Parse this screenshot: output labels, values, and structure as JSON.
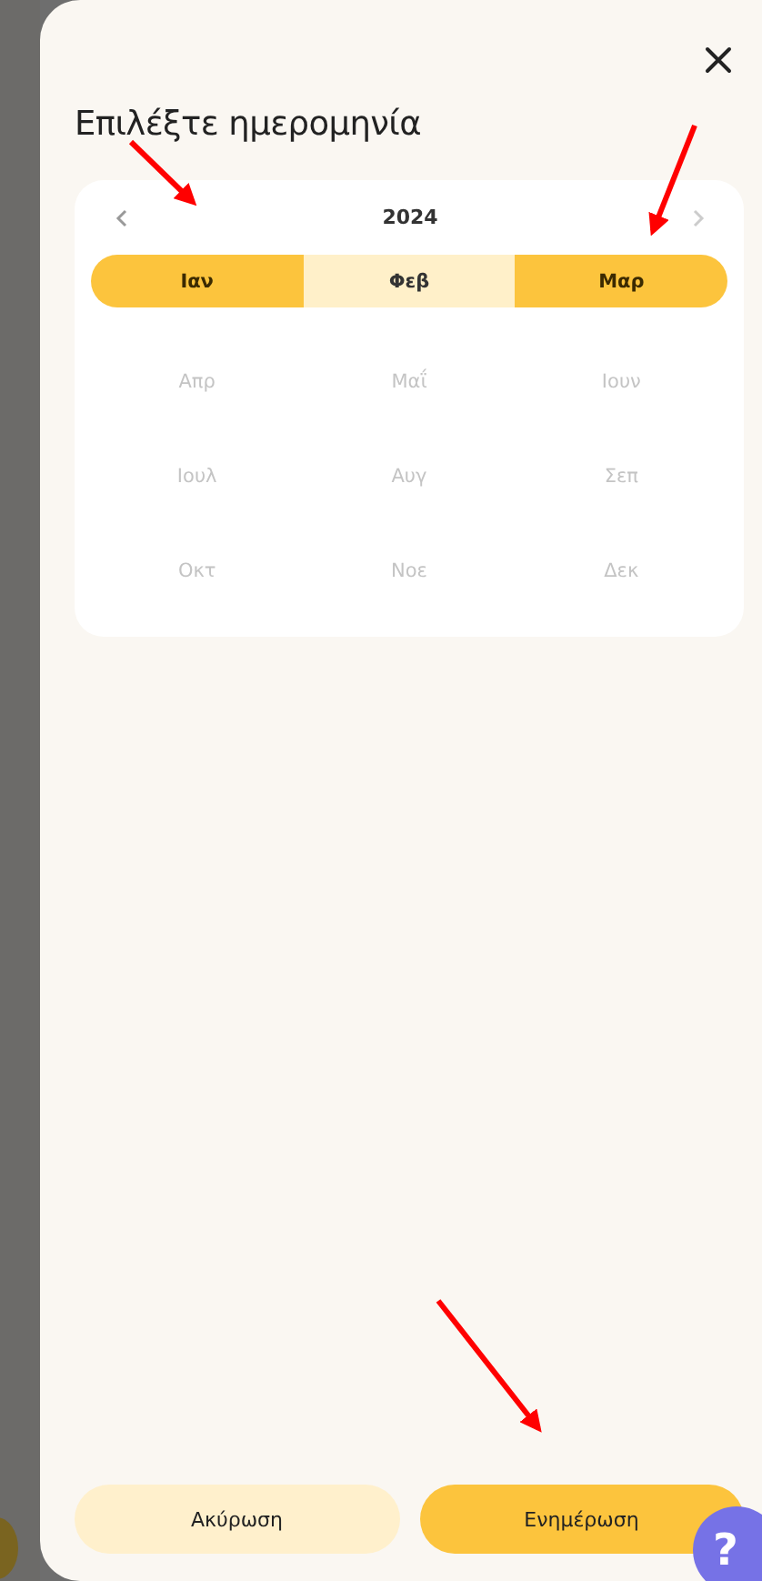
{
  "dialog": {
    "title": "Επιλέξτε ημερομηνία",
    "year": "2024",
    "months": [
      {
        "label": "Ιαν",
        "selected": true,
        "in_range": false,
        "disabled": false
      },
      {
        "label": "Φεβ",
        "selected": false,
        "in_range": true,
        "disabled": false
      },
      {
        "label": "Μαρ",
        "selected": true,
        "in_range": false,
        "disabled": false
      },
      {
        "label": "Απρ",
        "selected": false,
        "in_range": false,
        "disabled": true
      },
      {
        "label": "Μαΐ",
        "selected": false,
        "in_range": false,
        "disabled": true
      },
      {
        "label": "Ιουν",
        "selected": false,
        "in_range": false,
        "disabled": true
      },
      {
        "label": "Ιουλ",
        "selected": false,
        "in_range": false,
        "disabled": true
      },
      {
        "label": "Αυγ",
        "selected": false,
        "in_range": false,
        "disabled": true
      },
      {
        "label": "Σεπ",
        "selected": false,
        "in_range": false,
        "disabled": true
      },
      {
        "label": "Οκτ",
        "selected": false,
        "in_range": false,
        "disabled": true
      },
      {
        "label": "Νοε",
        "selected": false,
        "in_range": false,
        "disabled": true
      },
      {
        "label": "Δεκ",
        "selected": false,
        "in_range": false,
        "disabled": true
      }
    ],
    "buttons": [
      {
        "label": "Ακύρωση",
        "kind": "secondary"
      },
      {
        "label": "Ενημέρωση",
        "kind": "primary"
      }
    ]
  },
  "help_button": {
    "label": "?"
  }
}
